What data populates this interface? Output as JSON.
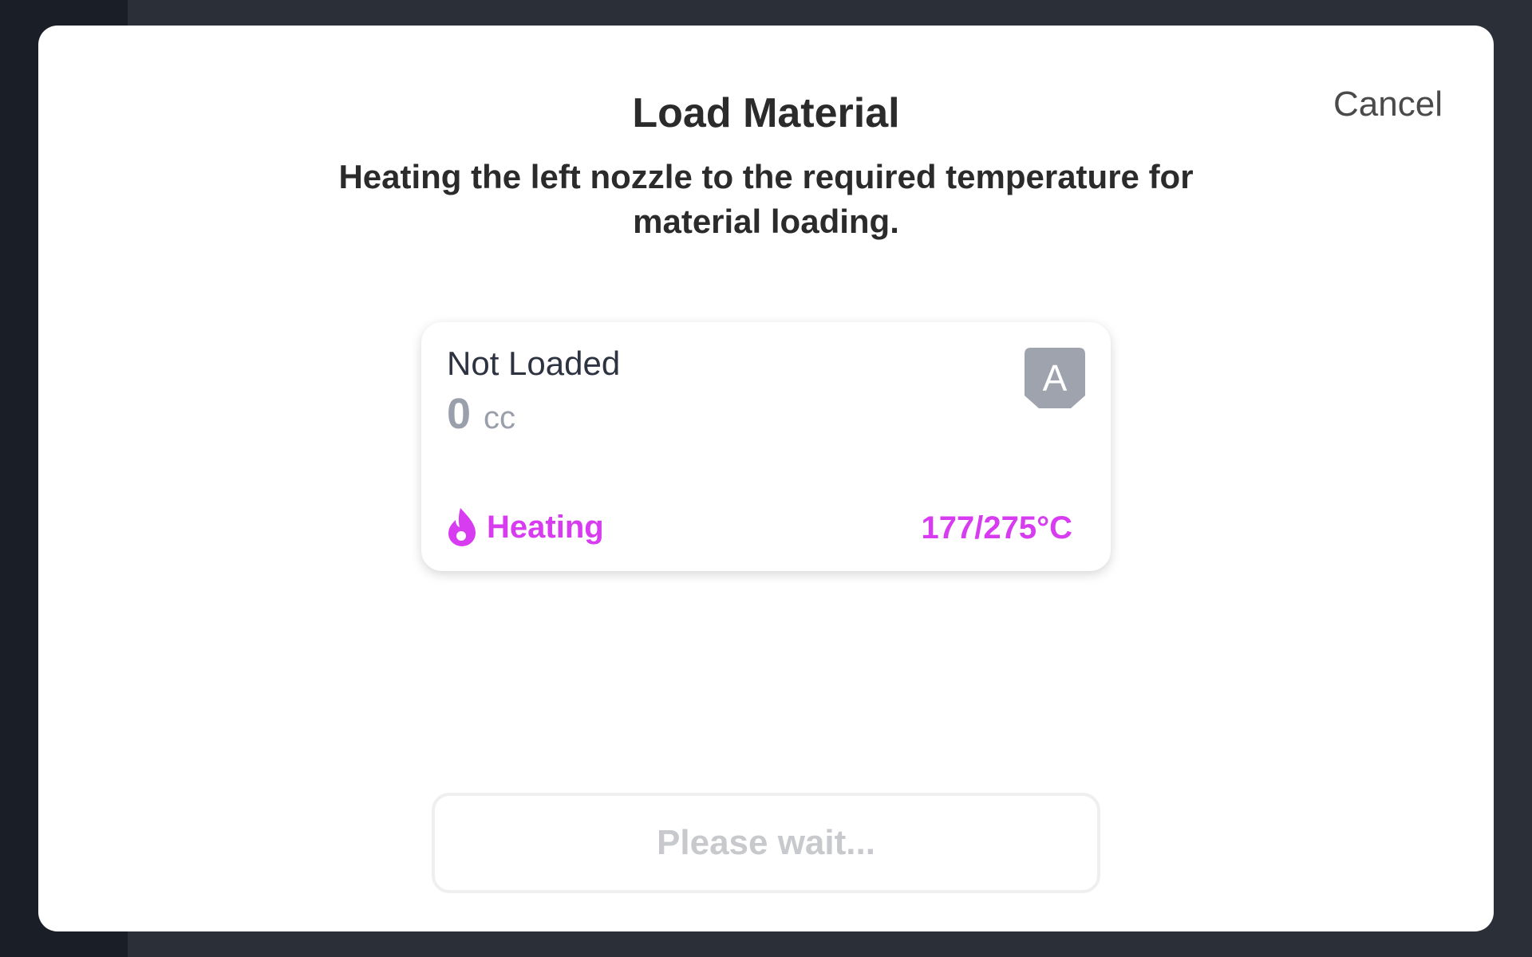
{
  "modal": {
    "title": "Load Material",
    "cancel_label": "Cancel",
    "instruction": "Heating the left nozzle to the required temperature for material loading.",
    "wait_button_label": "Please wait..."
  },
  "material_card": {
    "status": "Not Loaded",
    "volume_value": "0",
    "volume_unit": "cc",
    "nozzle_label": "A",
    "heating_label": "Heating",
    "temperature": "177/275°C"
  },
  "icons": {
    "flame": "flame-icon",
    "nozzle_badge": "nozzle-badge-icon"
  },
  "colors": {
    "accent_heating": "#d83cf0",
    "badge_gray": "#9ea3ad",
    "disabled_text": "#c8c9cc",
    "backdrop": "#2b2f38"
  }
}
